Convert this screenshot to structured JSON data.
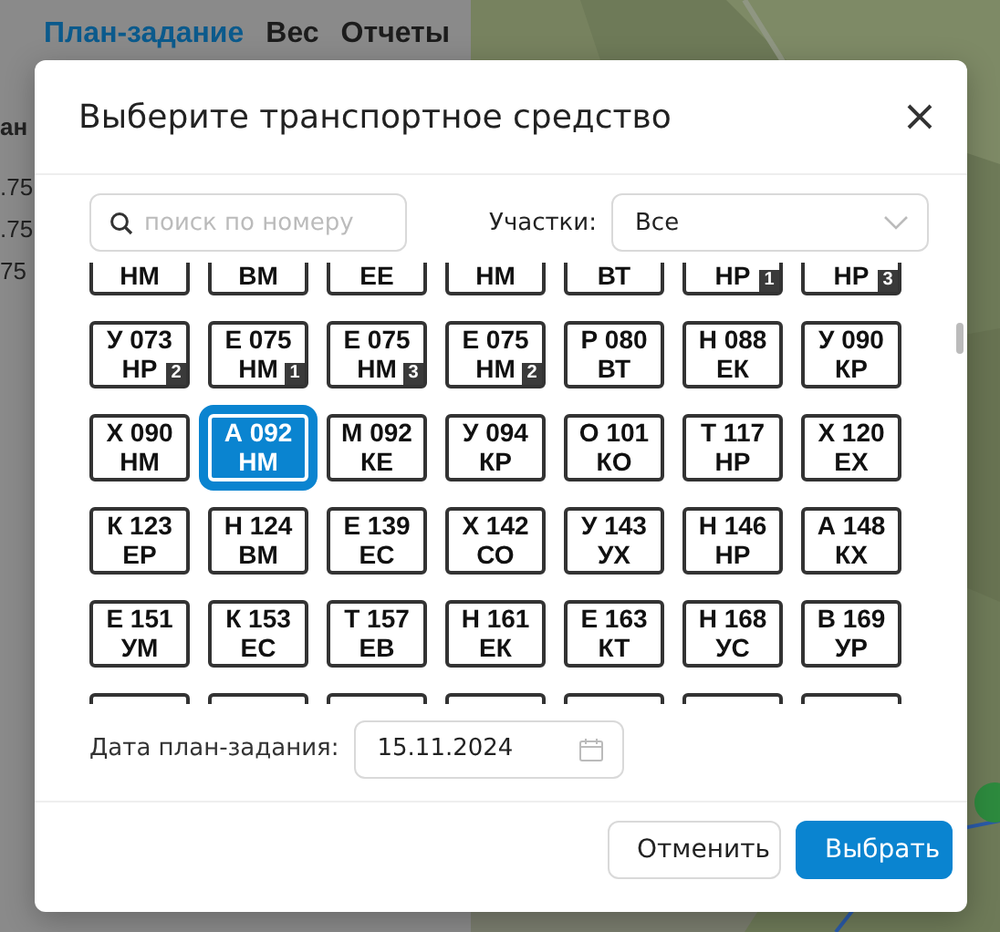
{
  "app": {
    "tabs": [
      {
        "label": "План-задание",
        "selected": true
      },
      {
        "label": "Вес",
        "selected": false
      },
      {
        "label": "Отчеты",
        "selected": false
      }
    ],
    "side_texts": [
      "ан",
      ".75",
      ".75",
      "75"
    ]
  },
  "dialog": {
    "title": "Выберите транспортное средство",
    "search": {
      "placeholder": "поиск по номеру"
    },
    "area_filter": {
      "label": "Участки:",
      "value": "Все"
    },
    "vehicles": [
      {
        "line2": "НМ",
        "selected": false
      },
      {
        "line2": "ВМ",
        "selected": false
      },
      {
        "line2": "ЕЕ",
        "selected": false
      },
      {
        "line2": "НМ",
        "selected": false
      },
      {
        "line2": "ВТ",
        "selected": false
      },
      {
        "line2": "НР",
        "badge": "1",
        "selected": false
      },
      {
        "line2": "НР",
        "badge": "3",
        "selected": false
      },
      {
        "line1": "У 073",
        "line2": "НР",
        "badge": "2",
        "selected": false
      },
      {
        "line1": "Е 075",
        "line2": "НМ",
        "badge": "1",
        "selected": false
      },
      {
        "line1": "Е 075",
        "line2": "НМ",
        "badge": "3",
        "selected": false
      },
      {
        "line1": "Е 075",
        "line2": "НМ",
        "badge": "2",
        "selected": false
      },
      {
        "line1": "Р 080",
        "line2": "ВТ",
        "selected": false
      },
      {
        "line1": "Н 088",
        "line2": "ЕК",
        "selected": false
      },
      {
        "line1": "У 090",
        "line2": "КР",
        "selected": false
      },
      {
        "line1": "Х 090",
        "line2": "НМ",
        "selected": false
      },
      {
        "line1": "А 092",
        "line2": "НМ",
        "selected": true
      },
      {
        "line1": "М 092",
        "line2": "КЕ",
        "selected": false
      },
      {
        "line1": "У 094",
        "line2": "КР",
        "selected": false
      },
      {
        "line1": "О 101",
        "line2": "КО",
        "selected": false
      },
      {
        "line1": "Т 117",
        "line2": "НР",
        "selected": false
      },
      {
        "line1": "Х 120",
        "line2": "ЕХ",
        "selected": false
      },
      {
        "line1": "К 123",
        "line2": "ЕР",
        "selected": false
      },
      {
        "line1": "Н 124",
        "line2": "ВМ",
        "selected": false
      },
      {
        "line1": "Е 139",
        "line2": "ЕС",
        "selected": false
      },
      {
        "line1": "Х 142",
        "line2": "СО",
        "selected": false
      },
      {
        "line1": "У 143",
        "line2": "УХ",
        "selected": false
      },
      {
        "line1": "Н 146",
        "line2": "НР",
        "selected": false
      },
      {
        "line1": "А 148",
        "line2": "КХ",
        "selected": false
      },
      {
        "line1": "Е 151",
        "line2": "УМ",
        "selected": false
      },
      {
        "line1": "К 153",
        "line2": "ЕС",
        "selected": false
      },
      {
        "line1": "Т 157",
        "line2": "ЕВ",
        "selected": false
      },
      {
        "line1": "Н 161",
        "line2": "ЕК",
        "selected": false
      },
      {
        "line1": "Е 163",
        "line2": "КТ",
        "selected": false
      },
      {
        "line1": "Н 168",
        "line2": "УС",
        "selected": false
      },
      {
        "line1": "В 169",
        "line2": "УР",
        "selected": false
      }
    ],
    "date": {
      "label": "Дата план-задания:",
      "value": "15.11.2024"
    },
    "buttons": [
      {
        "label": "Отменить",
        "kind": "secondary"
      },
      {
        "label": "Выбрать",
        "kind": "primary"
      }
    ]
  }
}
